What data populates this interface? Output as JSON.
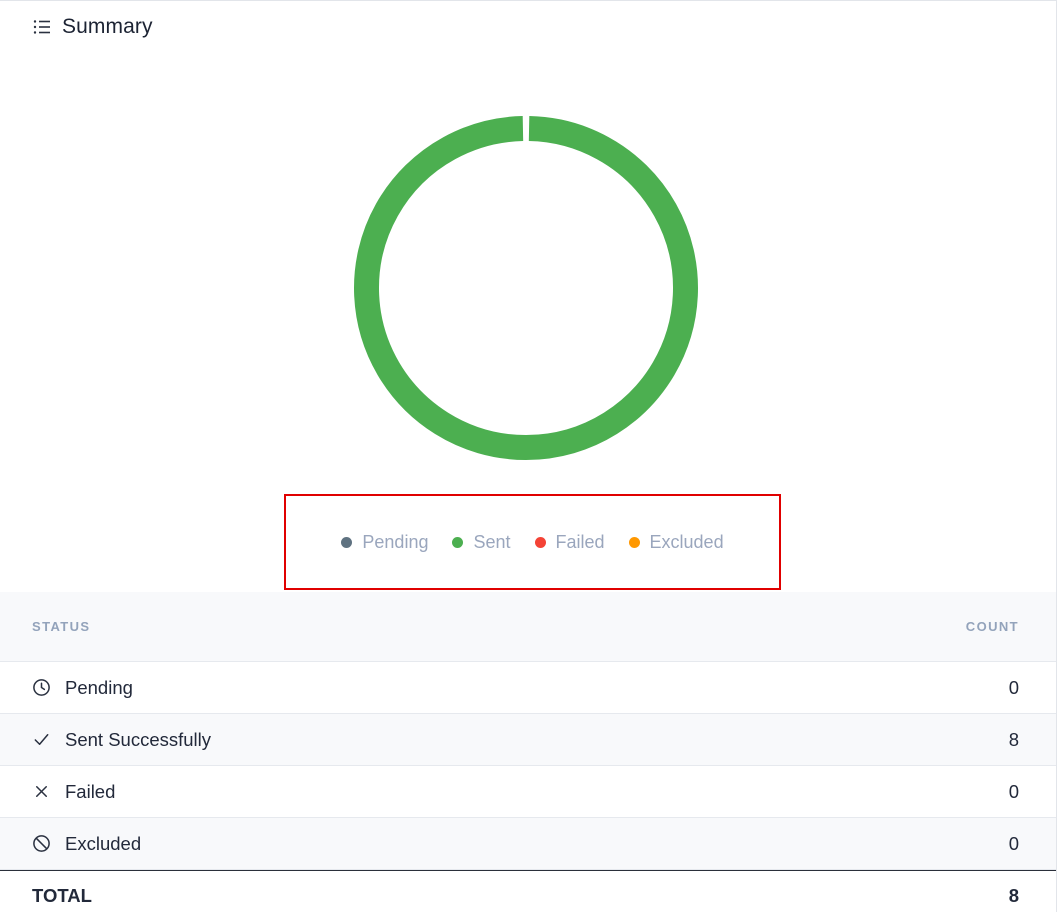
{
  "header": {
    "title": "Summary",
    "icon": "list-icon"
  },
  "chart_data": {
    "type": "pie",
    "style": "donut",
    "categories": [
      "Pending",
      "Sent",
      "Failed",
      "Excluded"
    ],
    "values": [
      0,
      8,
      0,
      0
    ],
    "colors": [
      "#5f7281",
      "#4caf50",
      "#f44336",
      "#ff9800"
    ],
    "legend_position": "bottom"
  },
  "legend": {
    "items": [
      {
        "label": "Pending",
        "color": "#5f7281"
      },
      {
        "label": "Sent",
        "color": "#4caf50"
      },
      {
        "label": "Failed",
        "color": "#f44336"
      },
      {
        "label": "Excluded",
        "color": "#ff9800"
      }
    ]
  },
  "table": {
    "headers": {
      "status": "STATUS",
      "count": "COUNT"
    },
    "rows": [
      {
        "icon": "clock-icon",
        "label": "Pending",
        "count": "0"
      },
      {
        "icon": "check-icon",
        "label": "Sent Successfully",
        "count": "8"
      },
      {
        "icon": "x-icon",
        "label": "Failed",
        "count": "0"
      },
      {
        "icon": "ban-icon",
        "label": "Excluded",
        "count": "0"
      }
    ],
    "total": {
      "label": "TOTAL",
      "count": "8"
    }
  }
}
